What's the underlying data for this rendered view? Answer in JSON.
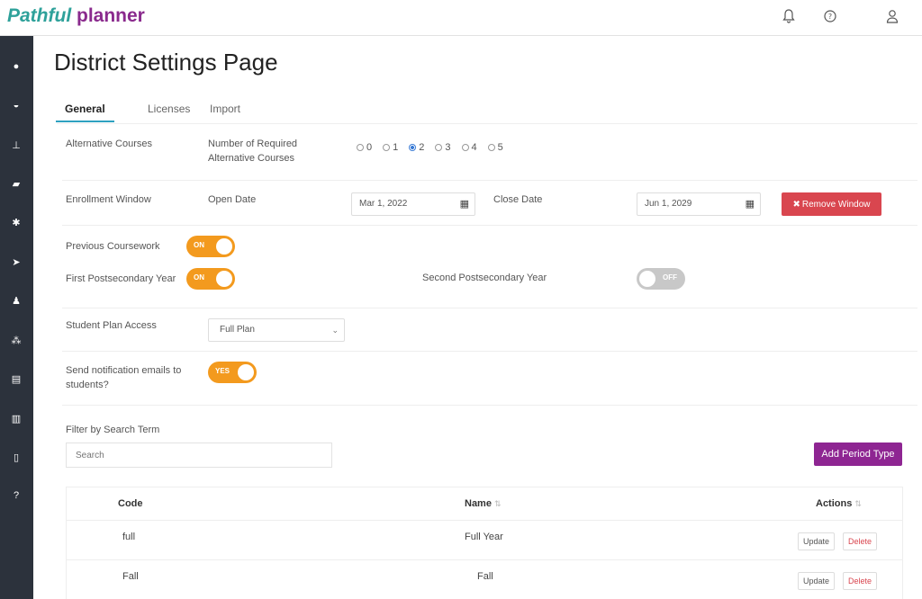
{
  "brand": {
    "part1": "Pathful",
    "part2": " planner"
  },
  "page_title": "District Settings Page",
  "tabs": [
    "General",
    "Licenses",
    "Import"
  ],
  "settings": {
    "alt_courses_label": "Alternative Courses",
    "num_required_label": "Number of Required Alternative Courses",
    "radio_options": [
      "0",
      "1",
      "2",
      "3",
      "4",
      "5"
    ],
    "radio_selected": "2",
    "enrollment_label": "Enrollment Window",
    "open_date_label": "Open Date",
    "open_date_value": "Mar 1, 2022",
    "close_date_label": "Close Date",
    "close_date_value": "Jun 1, 2029",
    "remove_window_label": "Remove Window",
    "prev_coursework_label": "Previous Coursework",
    "prev_coursework_toggle": "ON",
    "first_post_label": "First Postsecondary Year",
    "first_post_toggle": "ON",
    "second_post_label": "Second Postsecondary Year",
    "second_post_toggle": "OFF",
    "plan_access_label": "Student Plan Access",
    "plan_access_value": "Full Plan",
    "notify_label": "Send notification emails to students?",
    "notify_toggle": "YES"
  },
  "filter": {
    "label": "Filter by Search Term",
    "placeholder": "Search",
    "add_button": "Add Period Type"
  },
  "table": {
    "headers": [
      "Code",
      "Name",
      "Actions"
    ],
    "rows": [
      {
        "code": "full",
        "name": "Full Year",
        "update": "Update",
        "delete": "Delete"
      },
      {
        "code": "Fall",
        "name": "Fall",
        "update": "Update",
        "delete": "Delete"
      }
    ]
  },
  "colors": {
    "accent_teal": "#2ea19a",
    "brand_purple": "#8e2592",
    "toggle_on": "#f39a1e",
    "danger": "#d9464f",
    "sidebar": "#2c323c"
  },
  "icons": {
    "topbar": [
      "bell-icon",
      "help-icon",
      "user-icon"
    ],
    "sidebar": [
      "dashboard-icon",
      "gauge-icon",
      "sitemap-icon",
      "folder-icon",
      "gear-icon",
      "location-arrow-icon",
      "person-icon",
      "group-icon",
      "table-icon",
      "book-icon",
      "map-icon",
      "question-icon"
    ]
  }
}
